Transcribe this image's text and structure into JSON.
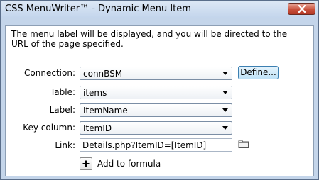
{
  "window": {
    "title": "CSS MenuWriter™ - Dynamic Menu Item"
  },
  "description": "The menu label will be displayed, and you will be directed to the URL of the page specified.",
  "form": {
    "connection": {
      "label": "Connection:",
      "value": "connBSM"
    },
    "define_button": "Define...",
    "table": {
      "label": "Table:",
      "value": "items"
    },
    "label_field": {
      "label": "Label:",
      "value": "ItemName"
    },
    "key_column": {
      "label": "Key column:",
      "value": "ItemID"
    },
    "link": {
      "label": "Link:",
      "value": "Details.php?ItemID=[ItemID]"
    },
    "add_to_formula": "Add to formula"
  },
  "icons": {
    "close": "close-icon",
    "folder": "folder-icon",
    "plus": "plus-icon"
  }
}
